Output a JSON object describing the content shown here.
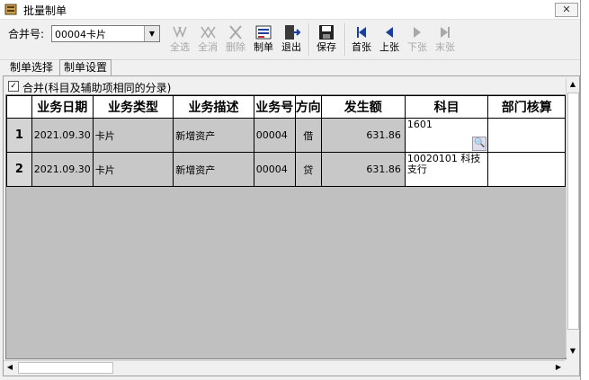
{
  "window": {
    "title": "批量制单",
    "close_glyph": "✕"
  },
  "toolbar": {
    "merge_label": "合并号:",
    "merge_value": "00004卡片",
    "buttons": [
      {
        "label": "全选",
        "icon": "select-all-icon",
        "enabled": false
      },
      {
        "label": "全消",
        "icon": "deselect-all-icon",
        "enabled": false
      },
      {
        "label": "删除",
        "icon": "delete-x-icon",
        "enabled": false
      },
      {
        "label": "制单",
        "icon": "make-voucher-icon",
        "enabled": true
      },
      {
        "label": "退出",
        "icon": "exit-door-icon",
        "enabled": true
      },
      {
        "label": "保存",
        "icon": "floppy-disk-icon",
        "enabled": true
      },
      {
        "label": "首张",
        "icon": "first-record-icon",
        "enabled": true
      },
      {
        "label": "上张",
        "icon": "previous-record-icon",
        "enabled": true
      },
      {
        "label": "下张",
        "icon": "next-record-icon",
        "enabled": false
      },
      {
        "label": "末张",
        "icon": "last-record-icon",
        "enabled": false
      }
    ]
  },
  "tabs": [
    {
      "label": "制单选择",
      "active": false
    },
    {
      "label": "制单设置",
      "active": true
    }
  ],
  "options": {
    "merge_checkbox_label": "合并(科目及辅助项相同的分录)",
    "merge_checked": true
  },
  "grid": {
    "columns": [
      "业务日期",
      "业务类型",
      "业务描述",
      "业务号",
      "方向",
      "发生额",
      "科目",
      "部门核算"
    ],
    "rows": [
      {
        "no": "1",
        "date": "2021.09.30",
        "type": "卡片",
        "desc": "新增资产",
        "num": "00004",
        "dir": "借",
        "amount": "631.86",
        "subject": "1601",
        "dept": ""
      },
      {
        "no": "2",
        "date": "2021.09.30",
        "type": "卡片",
        "desc": "新增资产",
        "num": "00004",
        "dir": "贷",
        "amount": "631.86",
        "subject": "10020101  科技支行",
        "dept": ""
      }
    ]
  },
  "colors": {
    "window_bg": "#f0f0f0",
    "grid_bg": "#c0c0c0",
    "accent_icon": "#1b3f9a"
  }
}
